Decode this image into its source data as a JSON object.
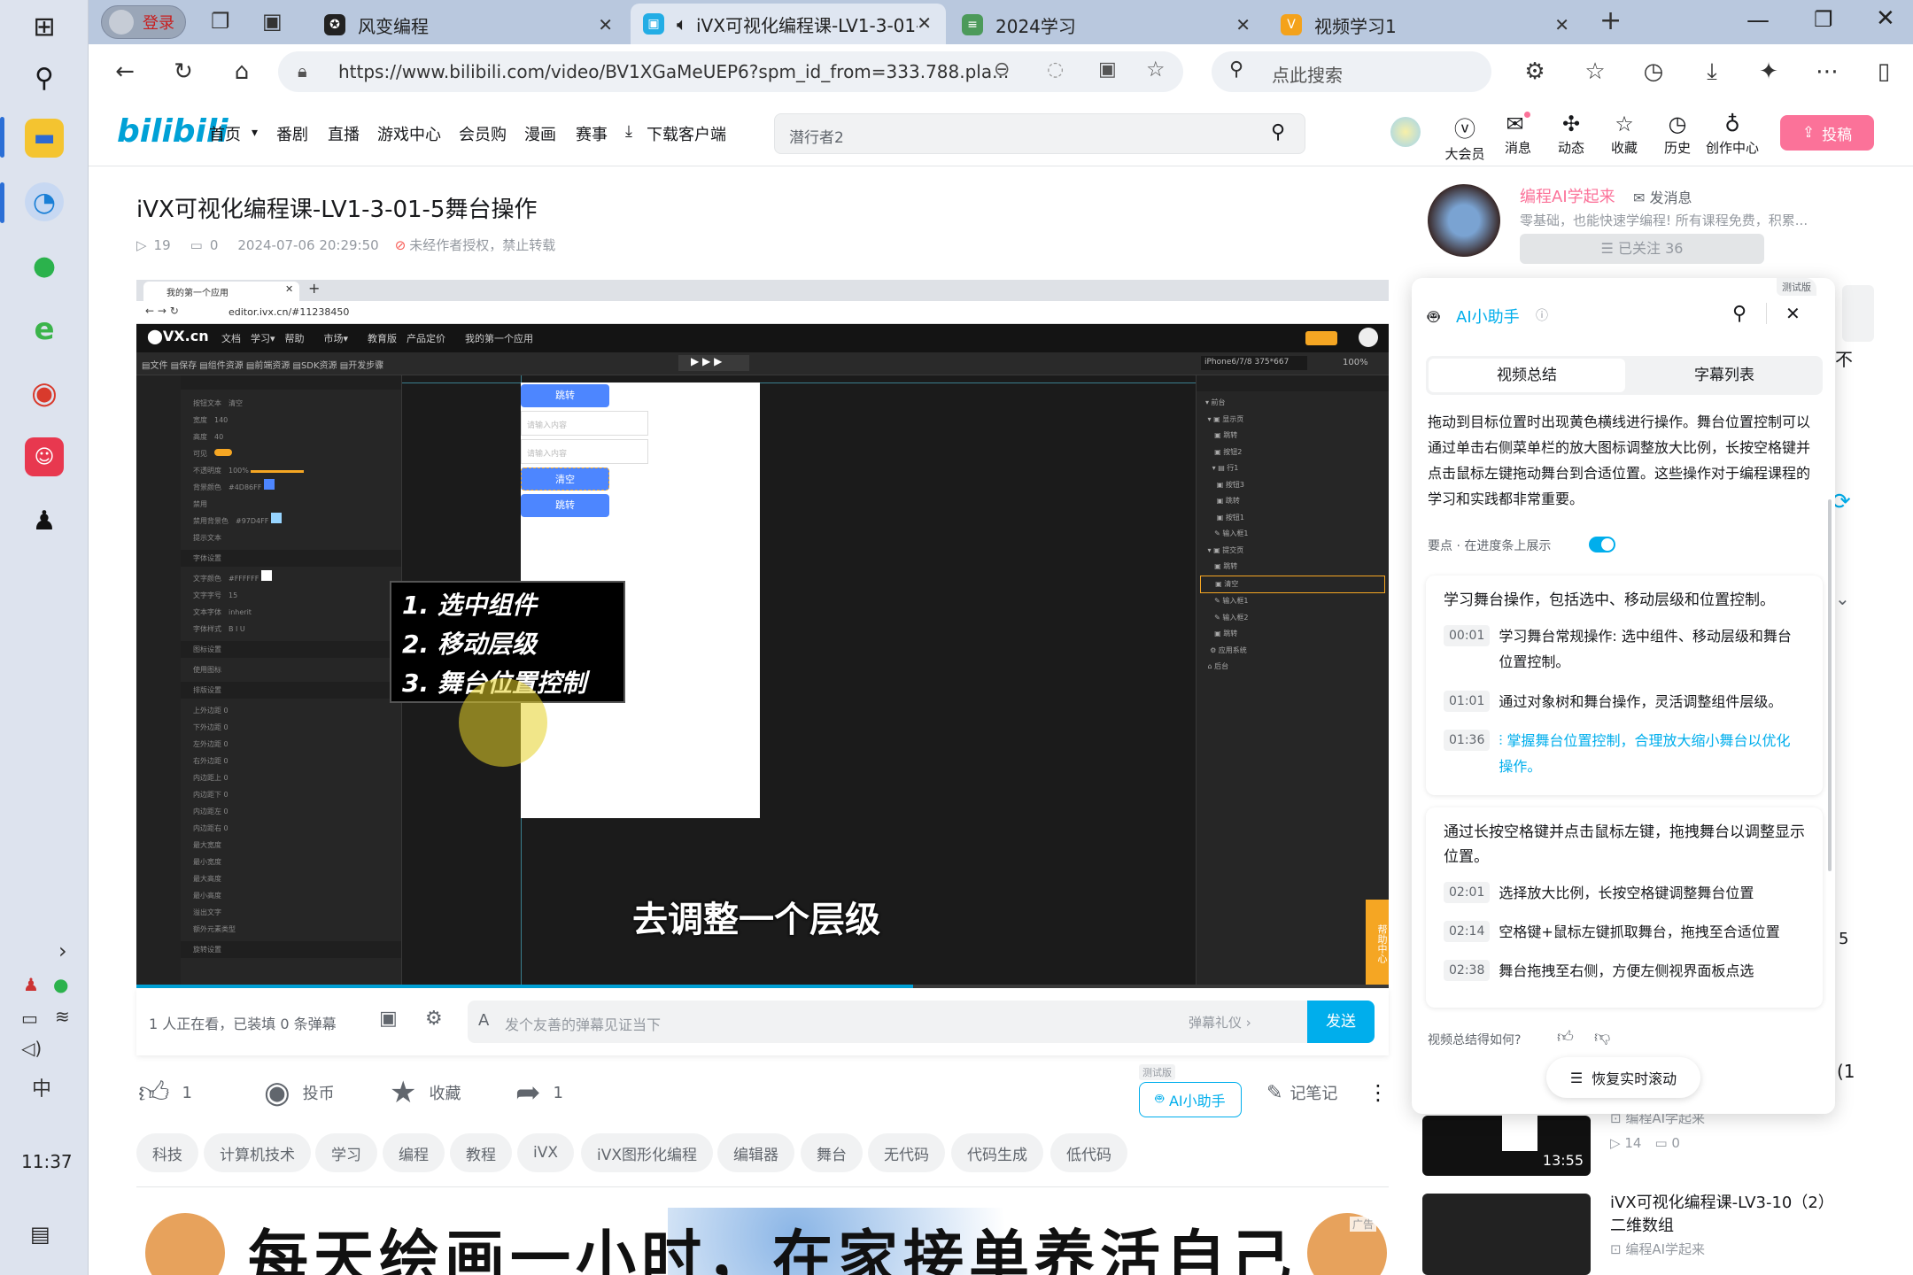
{
  "tabs": {
    "login": "登录",
    "t1": "风变编程",
    "t2": "iVX可视化编程课-LV1-3-01-5",
    "t3": "2024学习",
    "t4": "视频学习1"
  },
  "address": {
    "url": "https://www.bilibili.com/video/BV1XGaMeUEP6?spm_id_from=333.788.pla...",
    "search": "点此搜索"
  },
  "taskbar": {
    "time": "11:37",
    "ime": "中"
  },
  "nav": {
    "items": [
      "首页",
      "番剧",
      "直播",
      "游戏中心",
      "会员购",
      "漫画",
      "赛事",
      "下载客户端"
    ],
    "search_placeholder": "潜行者2",
    "icons": [
      "大会员",
      "消息",
      "动态",
      "收藏",
      "历史",
      "创作中心"
    ],
    "upload": "投稿"
  },
  "video": {
    "title": "iVX可视化编程课-LV1-3-01-5舞台操作",
    "plays": "19",
    "danmaku": "0",
    "date": "2024-07-06 20:29:50",
    "copyright": "未经作者授权，禁止转载"
  },
  "player": {
    "url": "editor.ivx.cn/#11238450",
    "tab": "我的第一个应用",
    "steps": [
      "1. 选中组件",
      "2. 移动层级",
      "3. 舞台位置控制"
    ],
    "subtitle": "去调整一个层级",
    "btn_jump": "跳转",
    "btn_clear": "清空",
    "input_ph": "请输入内容",
    "device": "iPhone6/7/8 375*667",
    "zoom": "100%",
    "help": "帮助中心"
  },
  "send": {
    "watching": "1 人正在看，已装填 0 条弹幕",
    "placeholder": "发个友善的弹幕见证当下",
    "etiquette": "弹幕礼仪 ›",
    "send": "发送"
  },
  "actions": {
    "like": "1",
    "coin": "投币",
    "fav": "收藏",
    "share": "1",
    "ai": "AI小助手",
    "ai_badge": "测试版",
    "notes": "记笔记"
  },
  "tags": [
    "科技",
    "计算机技术",
    "学习",
    "编程",
    "教程",
    "iVX",
    "iVX图形化编程",
    "编辑器",
    "舞台",
    "无代码",
    "代码生成",
    "低代码"
  ],
  "banner": {
    "text": "每天绘画一小时，在家接单养活自己",
    "ad": "广告"
  },
  "up": {
    "name": "编程AI学起来",
    "msg": "发消息",
    "desc": "零基础，也能快速学编程! 所有课程免费，积累...",
    "follow": "已关注 36"
  },
  "ai": {
    "badge": "测试版",
    "title": "AI小助手",
    "tab1": "视频总结",
    "tab2": "字幕列表",
    "summary": "拖动到目标位置时出现黄色横线进行操作。舞台位置控制可以通过单击右侧菜单栏的放大图标调整放大比例，长按空格键并点击鼠标左键拖动舞台到合适位置。这些操作对于编程课程的学习和实践都非常重要。",
    "toggle": "要点 · 在进度条上展示",
    "s1": {
      "title": "学习舞台操作，包括选中、移动层级和位置控制。",
      "items": [
        {
          "t": "00:01",
          "x": "学习舞台常规操作: 选中组件、移动层级和舞台位置控制。"
        },
        {
          "t": "01:01",
          "x": "通过对象树和舞台操作，灵活调整组件层级。"
        },
        {
          "t": "01:36",
          "x": "掌握舞台位置控制，合理放大缩小舞台以优化操作。"
        }
      ]
    },
    "s2": {
      "title": "通过长按空格键并点击鼠标左键，拖拽舞台以调整显示位置。",
      "items": [
        {
          "t": "02:01",
          "x": "选择放大比例，长按空格键调整舞台位置"
        },
        {
          "t": "02:14",
          "x": "空格键+鼠标左键抓取舞台，拖拽至合适位置"
        },
        {
          "t": "02:38",
          "x": "舞台拖拽至右侧，方便左侧视界面板点选"
        }
      ]
    },
    "feedback": "视频总结得如何?",
    "restore": "恢复实时滚动"
  },
  "rec": [
    {
      "dur": "13:55",
      "up": "编程AI学起来",
      "plays": "14",
      "dm": "0"
    },
    {
      "title": "iVX可视化编程课-LV3-10（2）二维数组",
      "up": "编程AI学起来"
    }
  ],
  "side_peek": [
    "不",
    "5",
    "(1"
  ]
}
